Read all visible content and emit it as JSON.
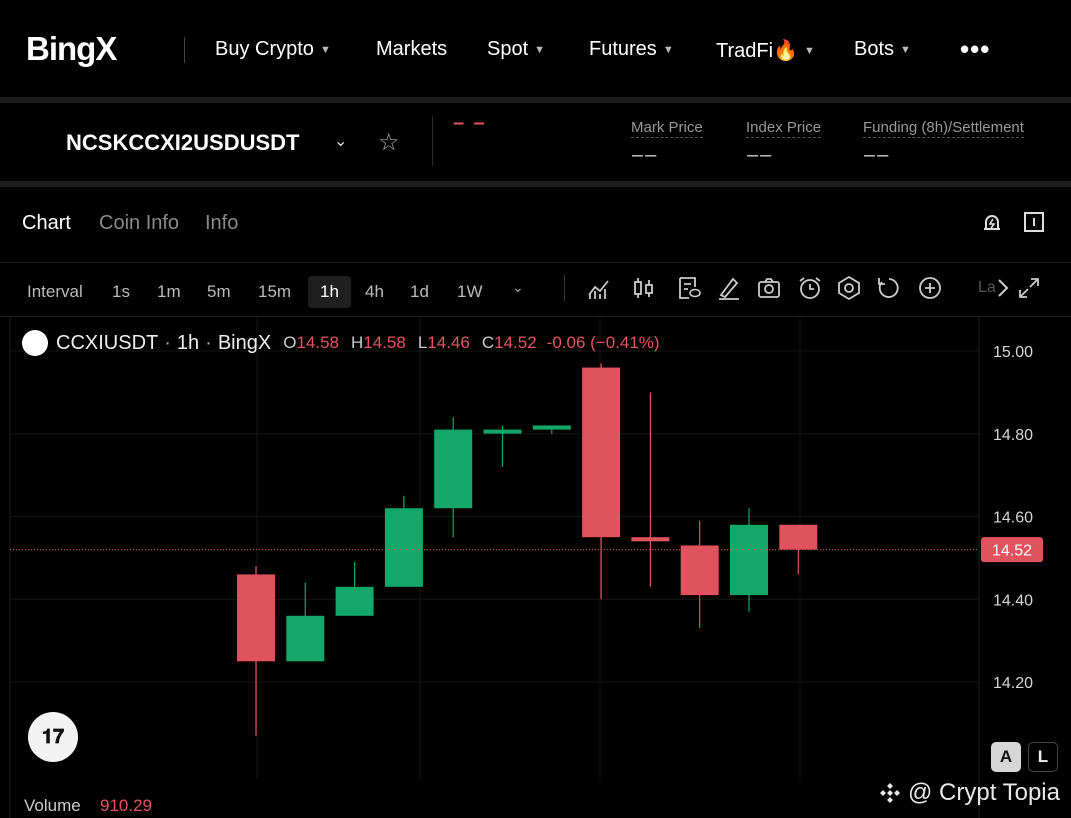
{
  "brand": {
    "logo_text": "BingX"
  },
  "nav": {
    "items": [
      {
        "label": "Buy Crypto",
        "dropdown": true
      },
      {
        "label": "Markets",
        "dropdown": false
      },
      {
        "label": "Spot",
        "dropdown": true
      },
      {
        "label": "Futures",
        "dropdown": true
      },
      {
        "label": "TradFi🔥",
        "dropdown": true
      },
      {
        "label": "Bots",
        "dropdown": true
      }
    ],
    "more": "•••"
  },
  "ticker": {
    "symbol": "NCSKCCXI2USDUSDT",
    "last_price": "– –",
    "stats": [
      {
        "label": "Mark Price",
        "value": "––"
      },
      {
        "label": "Index Price",
        "value": "––"
      },
      {
        "label": "Funding (8h)/Settlement",
        "value": "––"
      }
    ]
  },
  "tabs": {
    "chart": "Chart",
    "coin_info": "Coin Info",
    "info": "Info"
  },
  "intervals": {
    "label": "Interval",
    "options": [
      "1s",
      "1m",
      "5m",
      "15m",
      "1h",
      "4h",
      "1d",
      "1W"
    ],
    "selected": "1h"
  },
  "toolbar": {
    "icons": [
      "indicators-icon",
      "candle-type-icon",
      "template-icon",
      "draw-icon",
      "screenshot-icon",
      "alarm-icon",
      "settings-icon",
      "replay-icon",
      "add-icon"
    ],
    "lang_hint": "La"
  },
  "legend": {
    "symbol": "CCXIUSDT",
    "interval": "1h",
    "exchange": "BingX",
    "o_label": "O",
    "o": "14.58",
    "h_label": "H",
    "h": "14.58",
    "l_label": "L",
    "l": "14.46",
    "c_label": "C",
    "c": "14.52",
    "change": "-0.06 (−0.41%)"
  },
  "colors": {
    "up": "#13a86a",
    "down": "#e0525d",
    "background": "#000000"
  },
  "chart_data": {
    "type": "candlestick",
    "ylim": [
      14.1,
      15.05
    ],
    "y_ticks": [
      "15.00",
      "14.80",
      "14.60",
      "14.40",
      "14.20"
    ],
    "last_price_label": "14.52",
    "candles": [
      {
        "o": 14.46,
        "h": 14.48,
        "l": 14.07,
        "c": 14.25
      },
      {
        "o": 14.25,
        "h": 14.44,
        "l": 14.25,
        "c": 14.36
      },
      {
        "o": 14.36,
        "h": 14.49,
        "l": 14.36,
        "c": 14.43
      },
      {
        "o": 14.43,
        "h": 14.65,
        "l": 14.43,
        "c": 14.62
      },
      {
        "o": 14.62,
        "h": 14.84,
        "l": 14.55,
        "c": 14.81
      },
      {
        "o": 14.81,
        "h": 14.82,
        "l": 14.72,
        "c": 14.81
      },
      {
        "o": 14.81,
        "h": 14.82,
        "l": 14.8,
        "c": 14.82
      },
      {
        "o": 14.96,
        "h": 14.97,
        "l": 14.4,
        "c": 14.55
      },
      {
        "o": 14.55,
        "h": 14.9,
        "l": 14.43,
        "c": 14.54
      },
      {
        "o": 14.53,
        "h": 14.59,
        "l": 14.33,
        "c": 14.41
      },
      {
        "o": 14.41,
        "h": 14.62,
        "l": 14.37,
        "c": 14.58
      },
      {
        "o": 14.58,
        "h": 14.58,
        "l": 14.46,
        "c": 14.52
      }
    ],
    "volume_label": "Volume",
    "volume_value": "910.29"
  },
  "scale_buttons": {
    "auto": "A",
    "log": "L"
  },
  "watermark": "@ Crypt Topia"
}
